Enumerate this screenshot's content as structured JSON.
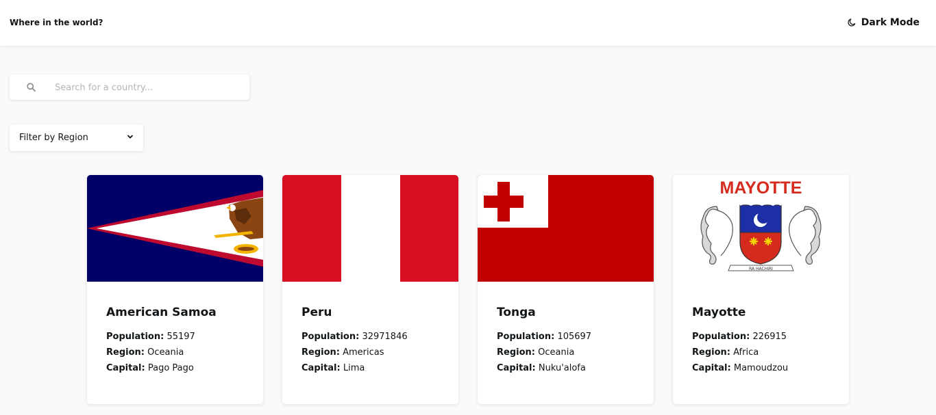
{
  "header": {
    "title": "Where in the world?",
    "dark_mode_label": "Dark Mode"
  },
  "search": {
    "placeholder": "Search for a country..."
  },
  "filter": {
    "selected": "Filter by Region"
  },
  "labels": {
    "population": "Population:",
    "region": "Region:",
    "capital": "Capital:"
  },
  "countries": [
    {
      "name": "American Samoa",
      "population": "55197",
      "region": "Oceania",
      "capital": "Pago Pago",
      "flag": "american-samoa-flag"
    },
    {
      "name": "Peru",
      "population": "32971846",
      "region": "Americas",
      "capital": "Lima",
      "flag": "peru-flag"
    },
    {
      "name": "Tonga",
      "population": "105697",
      "region": "Oceania",
      "capital": "Nuku'alofa",
      "flag": "tonga-flag"
    },
    {
      "name": "Mayotte",
      "population": "226915",
      "region": "Africa",
      "capital": "Mamoudzou",
      "flag": "mayotte-flag",
      "flag_text": "MAYOTTE",
      "motto": "RA HACHIRI"
    }
  ],
  "colors": {
    "background": "#fafafa",
    "card": "#ffffff",
    "text": "#111517",
    "samoa_blue": "#000066",
    "samoa_red": "#bf0a30",
    "peru_red": "#d91023",
    "tonga_red": "#c10000",
    "mayotte_red": "#d52b1e"
  }
}
